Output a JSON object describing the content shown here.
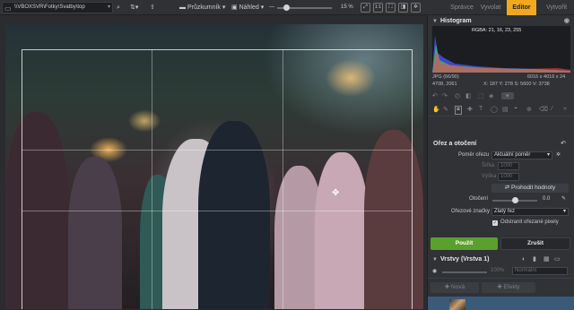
{
  "toolbar": {
    "path": "\\\\VBOXSVR\\Fotky\\Svatby\\top",
    "explorer_label": "Průzkumník",
    "preview_label": "Náhled",
    "zoom": "15 %"
  },
  "nav": {
    "tabs": [
      {
        "label": "Správce"
      },
      {
        "label": "Vyvolat"
      },
      {
        "label": "Editor"
      },
      {
        "label": "Vytvořit"
      }
    ]
  },
  "histogram": {
    "title": "Histogram",
    "rgba": "RGBA: 21, 16, 23, 255",
    "format": "JPG (66/90)",
    "size": "6016 x 4016 x 24",
    "coords": "4708, 2061",
    "exif": "X: 187 Y: 278 S: 5600 V: 3738"
  },
  "crop": {
    "title": "Ořez a otočení",
    "ratio_label": "Poměr ořezu",
    "ratio_value": "Aktuální poměr",
    "width_label": "Šířka",
    "width_value": "1000",
    "height_label": "Výška",
    "height_value": "1000",
    "swap_label": "Prohodit hodnoty",
    "rotate_label": "Otočení",
    "rotate_value": "0.0",
    "marks_label": "Ořezové značky",
    "marks_value": "Zlatý řez",
    "remove_label": "Odstranit ořezané pixely"
  },
  "actions": {
    "apply": "Použít",
    "cancel": "Zrušit"
  },
  "layers": {
    "title": "Vrstvy (Vrstva 1)",
    "opacity": "100%",
    "blend": "Normální",
    "new_label": "Nová",
    "effects_label": "Efekty"
  },
  "colors": {
    "accent": "#f2a81d",
    "apply_green": "#5aa02c"
  }
}
